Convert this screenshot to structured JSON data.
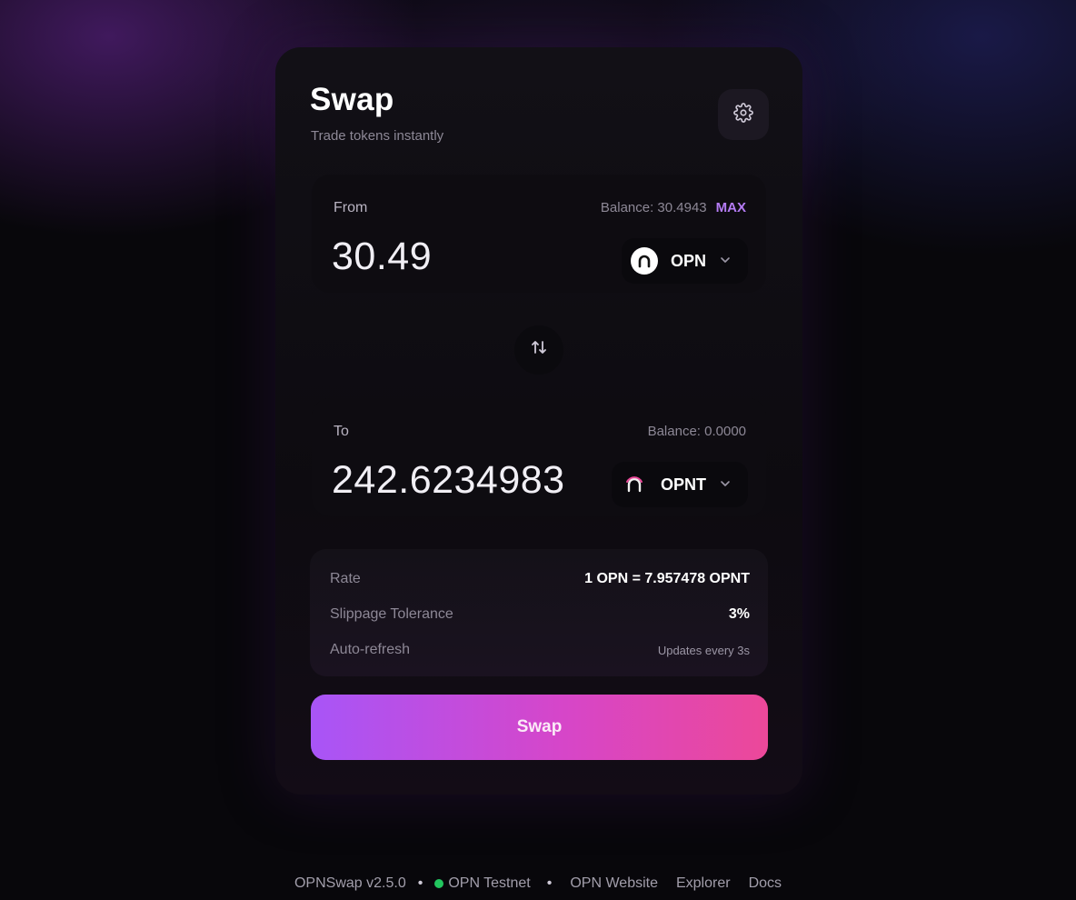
{
  "header": {
    "title": "Swap",
    "subtitle": "Trade tokens instantly"
  },
  "from": {
    "label": "From",
    "balance": "Balance: 30.4943",
    "max_label": "MAX",
    "amount": "30.49",
    "token": "OPN"
  },
  "to": {
    "label": "To",
    "balance": "Balance: 0.0000",
    "amount": "242.6234983",
    "token": "OPNT"
  },
  "info": {
    "rate_label": "Rate",
    "rate_value": "1 OPN = 7.957478 OPNT",
    "slippage_label": "Slippage Tolerance",
    "slippage_value": "3%",
    "refresh_label": "Auto-refresh",
    "refresh_value": "Updates every 3s"
  },
  "swap_button": "Swap",
  "footer": {
    "version": "OPNSwap v2.5.0",
    "network": "OPN Testnet",
    "links": [
      "OPN Website",
      "Explorer",
      "Docs"
    ]
  },
  "colors": {
    "accent": "#b57cf5",
    "button_start": "#a855f7",
    "button_end": "#ec4899",
    "network_status": "#22c55e"
  },
  "icons": {
    "settings": "gear-icon",
    "switch": "swap-arrows-icon",
    "dropdown": "chevron-down-icon"
  }
}
